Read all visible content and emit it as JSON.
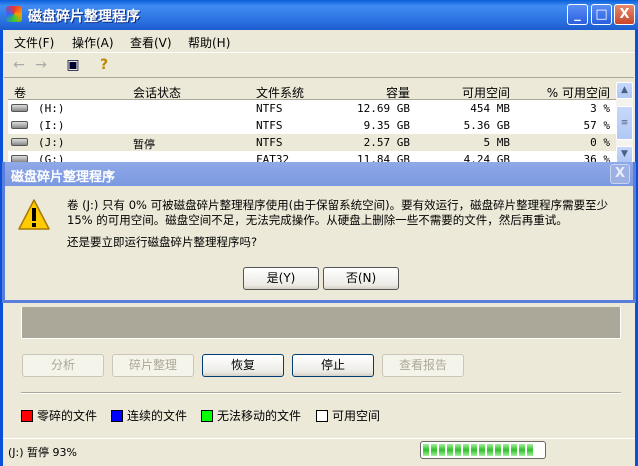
{
  "window": {
    "title": "磁盘碎片整理程序",
    "minimize": "_",
    "maximize": "□",
    "close": "X"
  },
  "menu": [
    "文件(F)",
    "操作(A)",
    "查看(V)",
    "帮助(H)"
  ],
  "toolbar": {
    "back_icon": "←",
    "forward_icon": "→",
    "console_icon": "▣",
    "help_icon": "?"
  },
  "list": {
    "columns": [
      "卷",
      "会话状态",
      "文件系统",
      "容量",
      "可用空间",
      "% 可用空间"
    ],
    "rows": [
      {
        "volume": "(H:)",
        "status": "",
        "fs": "NTFS",
        "capacity": "12.69 GB",
        "free": "454 MB",
        "pct": "3 %"
      },
      {
        "volume": "(I:)",
        "status": "",
        "fs": "NTFS",
        "capacity": "9.35 GB",
        "free": "5.36 GB",
        "pct": "57 %"
      },
      {
        "volume": "(J:)",
        "status": "暂停",
        "fs": "NTFS",
        "capacity": "2.57 GB",
        "free": "5 MB",
        "pct": "0 %"
      },
      {
        "volume": "(G:)",
        "status": "",
        "fs": "FAT32",
        "capacity": "11.84 GB",
        "free": "4.24 GB",
        "pct": "36 %"
      }
    ]
  },
  "dialog": {
    "title": "磁盘碎片整理程序",
    "message": "卷 (J:) 只有 0% 可被磁盘碎片整理程序使用(由于保留系统空间)。要有效运行，磁盘碎片整理程序需要至少 15% 的可用空间。磁盘空间不足，无法完成操作。从硬盘上删除一些不需要的文件，然后再重试。",
    "question": "还是要立即运行磁盘碎片整理程序吗?",
    "yes": "是(Y)",
    "no": "否(N)",
    "close": "X"
  },
  "buttons": {
    "analyze": "分析",
    "defrag": "碎片整理",
    "resume": "恢复",
    "stop": "停止",
    "report": "查看报告"
  },
  "legend": [
    {
      "label": "零碎的文件",
      "color": "#ff0000"
    },
    {
      "label": "连续的文件",
      "color": "#0000ff"
    },
    {
      "label": "无法移动的文件",
      "color": "#00ff00"
    },
    {
      "label": "可用空间",
      "color": "#ffffff"
    }
  ],
  "status": {
    "text": "(J:) 暂停 93%",
    "progress": 0.93
  }
}
